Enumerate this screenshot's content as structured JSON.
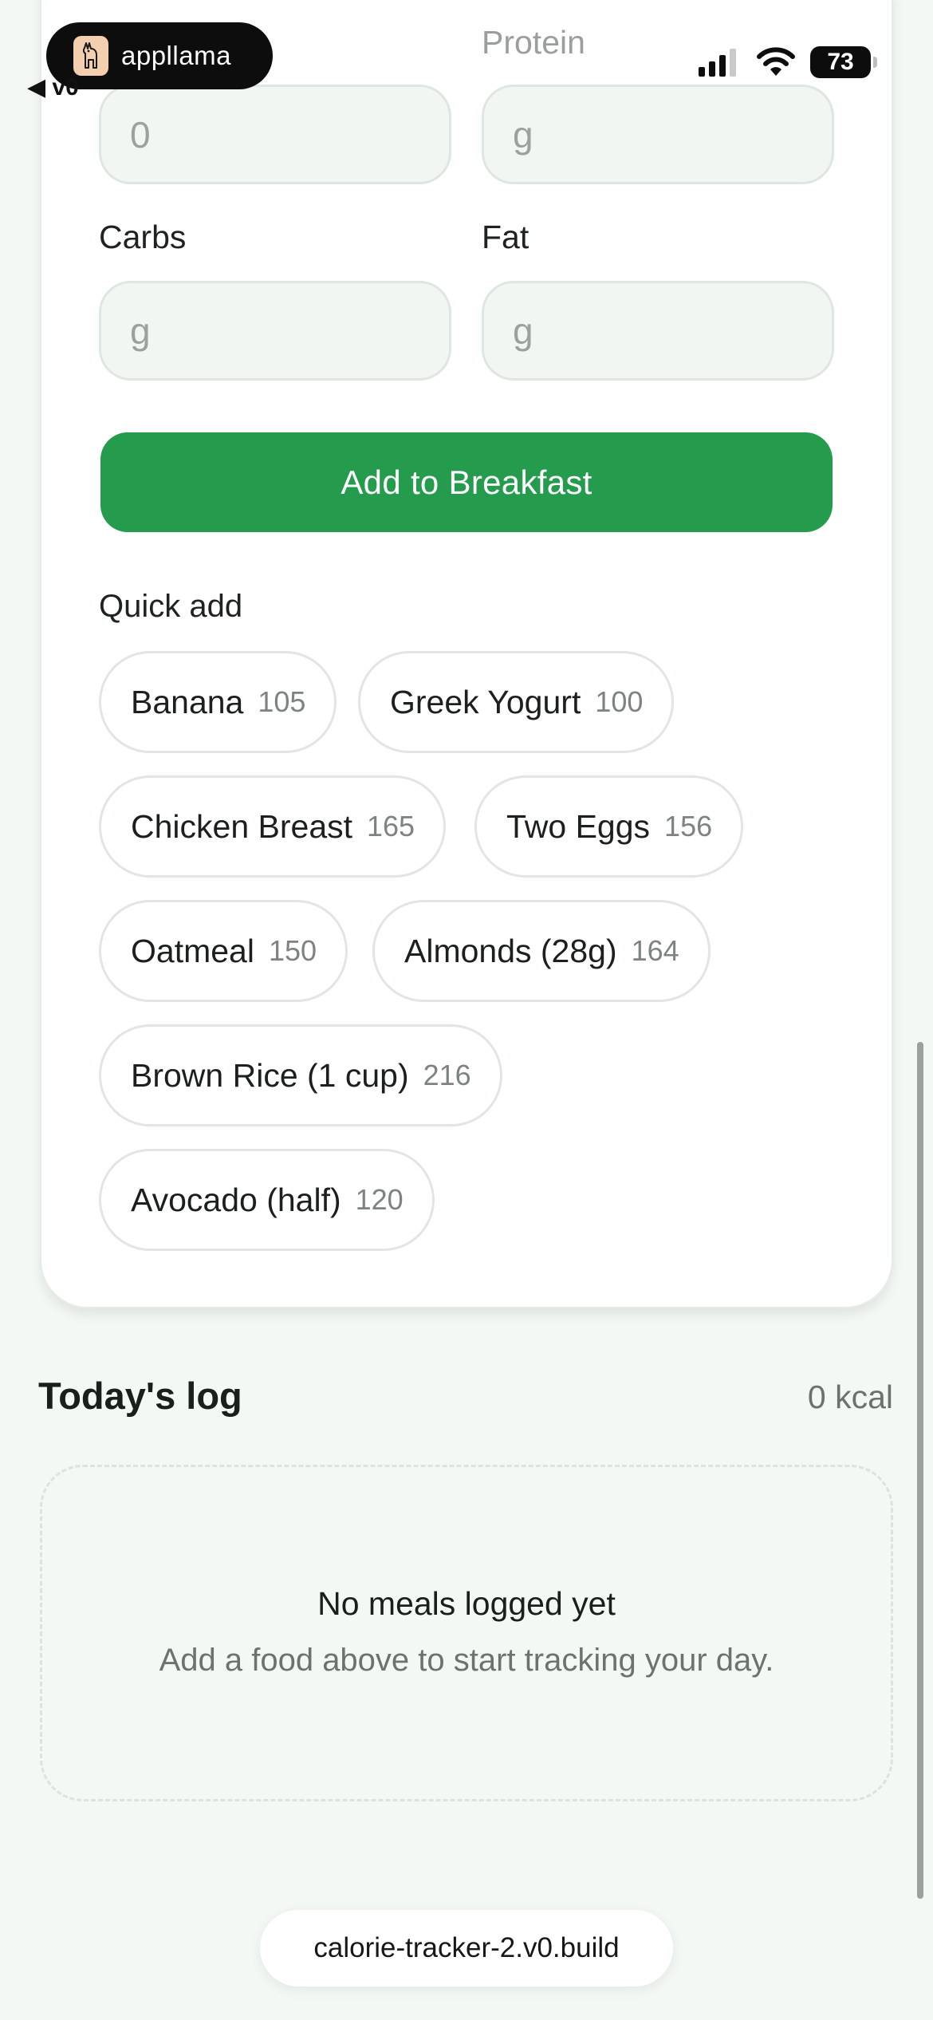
{
  "status_bar": {
    "brand": "appllama",
    "back_label": "◀ v0",
    "battery": "73"
  },
  "form": {
    "calories_value": "0",
    "protein_label": "Protein",
    "protein_placeholder": "g",
    "carbs_label": "Carbs",
    "carbs_placeholder": "g",
    "fat_label": "Fat",
    "fat_placeholder": "g",
    "add_button": "Add to Breakfast"
  },
  "quick_add": {
    "title": "Quick add",
    "items": [
      {
        "name": "Banana",
        "kcal": "105"
      },
      {
        "name": "Greek Yogurt",
        "kcal": "100"
      },
      {
        "name": "Chicken Breast",
        "kcal": "165"
      },
      {
        "name": "Two Eggs",
        "kcal": "156"
      },
      {
        "name": "Oatmeal",
        "kcal": "150"
      },
      {
        "name": "Almonds (28g)",
        "kcal": "164"
      },
      {
        "name": "Brown Rice (1 cup)",
        "kcal": "216"
      },
      {
        "name": "Avocado (half)",
        "kcal": "120"
      }
    ]
  },
  "log": {
    "title": "Today's log",
    "total": "0 kcal",
    "empty_title": "No meals logged yet",
    "empty_subtitle": "Add a food above to start tracking your day."
  },
  "footer": {
    "domain": "calorie-tracker-2.v0.build"
  },
  "colors": {
    "accent": "#259b4d",
    "background": "#f3f8f4"
  }
}
